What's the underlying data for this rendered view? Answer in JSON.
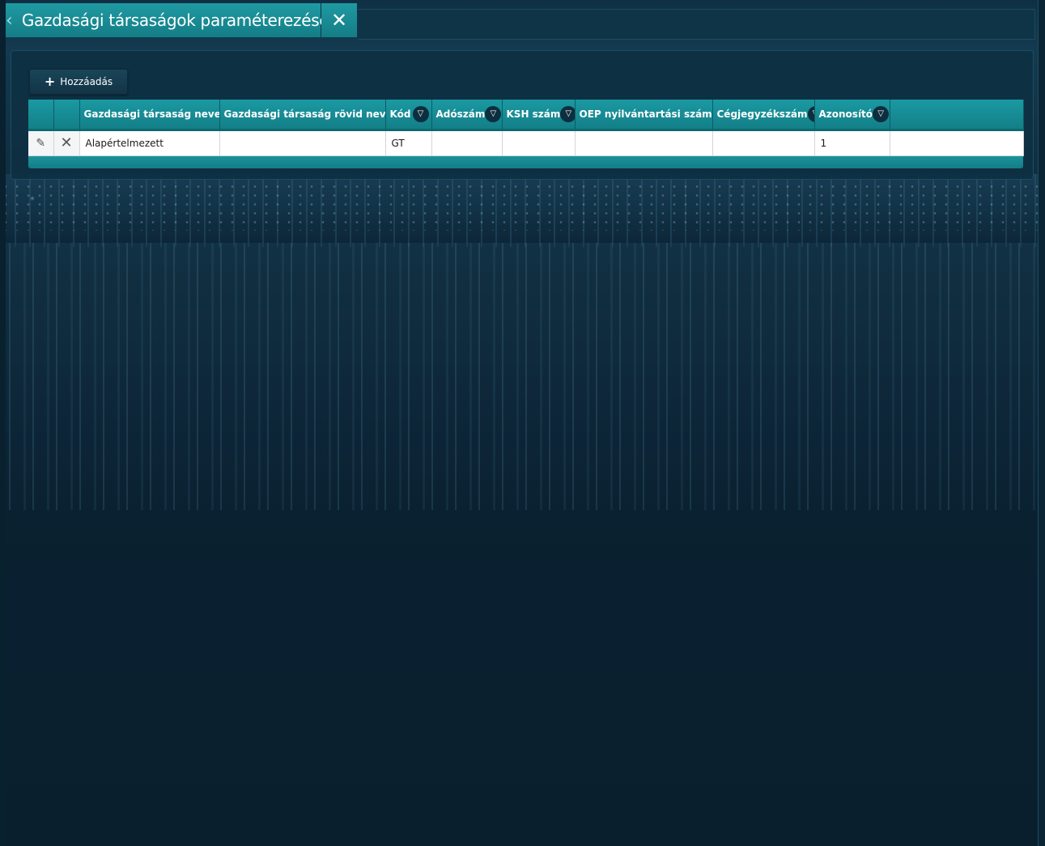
{
  "header": {
    "title": "Gazdasági társaságok paraméterezése",
    "back_icon": "‹",
    "close_icon": "✕"
  },
  "toolbar": {
    "add_label": "Hozzáadás"
  },
  "table": {
    "columns": [
      {
        "label": "Gazdasági társaság neve"
      },
      {
        "label": "Gazdasági társaság rövid neve"
      },
      {
        "label": "Kód"
      },
      {
        "label": "Adószám"
      },
      {
        "label": "KSH szám"
      },
      {
        "label": "OEP nyilvántartási szám"
      },
      {
        "label": "Cégjegyzékszám"
      },
      {
        "label": "Azonosító"
      }
    ],
    "filter_icon": "▽",
    "rows": [
      {
        "name": "Alapértelmezett",
        "short_name": "",
        "code": "GT",
        "tax_number": "",
        "ksh_number": "",
        "oep_number": "",
        "company_reg_number": "",
        "id": "1"
      }
    ]
  },
  "colors": {
    "accent": "#1b99a2",
    "panel": "#0e3042",
    "background": "#0b2233"
  }
}
